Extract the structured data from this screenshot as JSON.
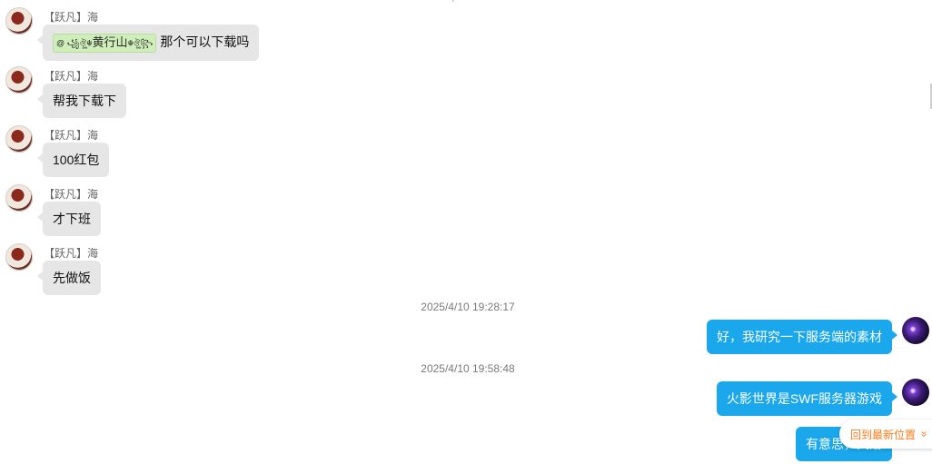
{
  "top_partial_text": "·  ·  /",
  "incoming": [
    {
      "sender": "【跃凡】海",
      "mention_name": "@ ꧁ঔৣ☬",
      "mention_main": "黄行山",
      "mention_tail": "☬ঔৣ꧂",
      "text": "那个可以下载吗"
    },
    {
      "sender": "【跃凡】海",
      "text": "帮我下载下"
    },
    {
      "sender": "【跃凡】海",
      "text": "100红包"
    },
    {
      "sender": "【跃凡】海",
      "text": "才下班"
    },
    {
      "sender": "【跃凡】海",
      "text": "先做饭"
    }
  ],
  "timestamps": [
    "2025/4/10 19:28:17",
    "2025/4/10 19:58:48"
  ],
  "outgoing": [
    {
      "text": "好，我研究一下服务端的素材"
    },
    {
      "text": "火影世界是SWF服务器游戏"
    },
    {
      "text": "有意思，又落"
    }
  ],
  "jump_latest": {
    "label": "回到最新位置",
    "icon": "chevrons-down-icon"
  },
  "colors": {
    "bubble_in": "#e6e6e6",
    "bubble_out": "#1aa7ec",
    "jump_text": "#ff7a1a",
    "mention_bg": "#cfeeb9"
  }
}
